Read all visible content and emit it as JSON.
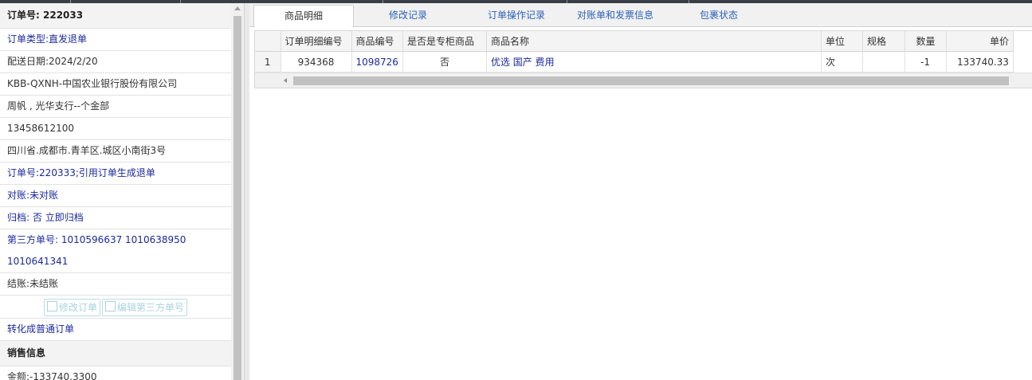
{
  "left_panel": {
    "order_no_label": "订单号:",
    "order_no": "222033",
    "order_type": "订单类型:直发退单",
    "delivery_date": "配送日期:2024/2/20",
    "customer": "KBB-QXNH-中国农业银行股份有限公司",
    "contact": "周帆 , 光华支行--个金部",
    "phone": "13458612100",
    "address": "四川省.成都市.青羊区.城区小南街3号",
    "ref_order": "订单号:220333;引用订单生成退单",
    "reconcile": "对账:未对账",
    "archive_label": "归档:",
    "archive_value": "否",
    "archive_action": "立即归档",
    "third_party_label": "第三方单号:",
    "third_party_line1": "1010596637 1010638950",
    "third_party_line2": "1010641341",
    "settlement": "结账:未结账",
    "edit_order_button": "修改订单",
    "edit_third_party_button": "编辑第三方单号",
    "convert_link": "转化成普通订单",
    "sales_header": "销售信息",
    "amount": "金额:-133740.3300"
  },
  "tabs": [
    {
      "label": "商品明细",
      "active": true
    },
    {
      "label": "修改记录",
      "active": false
    },
    {
      "label": "订单操作记录",
      "active": false
    },
    {
      "label": "对账单和发票信息",
      "active": false
    },
    {
      "label": "包裹状态",
      "active": false
    }
  ],
  "table": {
    "columns": [
      "订单明细编号",
      "商品编号",
      "是否是专柜商品",
      "商品名称",
      "单位",
      "规格",
      "数量",
      "单价"
    ],
    "rows": [
      {
        "index": "1",
        "detail_no": "934368",
        "product_no": "1098726",
        "counter": "否",
        "name": "优选 国产 费用",
        "unit": "次",
        "spec": "",
        "qty": "-1",
        "price": "133740.33"
      }
    ]
  },
  "colors": {
    "link": "#1c2a9c",
    "tab_text": "#2d63b8",
    "top_bar": "#3a3f47"
  }
}
